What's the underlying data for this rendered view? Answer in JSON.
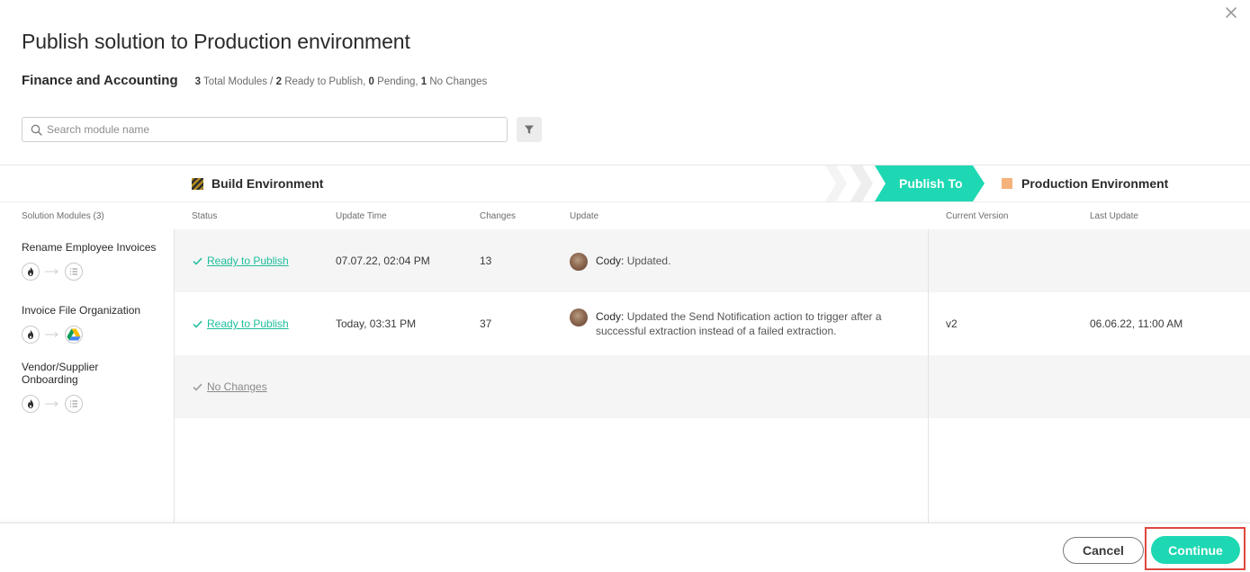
{
  "dialog": {
    "title": "Publish solution to Production environment",
    "close_icon": "close-icon"
  },
  "solution": {
    "name": "Finance and Accounting",
    "summary": {
      "total": "3",
      "total_label": "Total Modules /",
      "ready": "2",
      "ready_label": "Ready to Publish,",
      "pending": "0",
      "pending_label": "Pending,",
      "no_changes": "1",
      "no_changes_label": "No Changes"
    }
  },
  "search": {
    "placeholder": "Search module name",
    "value": "",
    "icon": "search-icon"
  },
  "filter": {
    "icon": "filter-icon"
  },
  "environments": {
    "source": "Build Environment",
    "action": "Publish To",
    "target": "Production Environment",
    "colors": {
      "publish_to": "#1dd8b3",
      "production": "#f5b27a",
      "build_stripe_1": "#b38b1e",
      "build_stripe_2": "#2e2e2e"
    }
  },
  "columns": {
    "modules": "Solution Modules (3)",
    "status": "Status",
    "update_time": "Update Time",
    "changes": "Changes",
    "update": "Update",
    "current_version": "Current Version",
    "last_update": "Last Update"
  },
  "rows": [
    {
      "name": "Rename Employee Invoices",
      "source_icon": "fire-icon",
      "target_icon": "list-icon",
      "status": "Ready to Publish",
      "update_time": "07.07.22, 02:04 PM",
      "changes": "13",
      "update_author": "Cody:",
      "update_text": "Updated.",
      "current_version": "",
      "last_update": ""
    },
    {
      "name": "Invoice File Organization",
      "source_icon": "fire-icon",
      "target_icon": "google-drive-icon",
      "status": "Ready to Publish",
      "update_time": "Today, 03:31 PM",
      "changes": "37",
      "update_author": "Cody:",
      "update_text": "Updated the Send Notification action to trigger after a successful extraction instead of a failed extraction.",
      "current_version": "v2",
      "last_update": "06.06.22, 11:00 AM"
    },
    {
      "name": "Vendor/Supplier Onboarding",
      "source_icon": "fire-icon",
      "target_icon": "list-icon",
      "status": "No Changes",
      "update_time": "",
      "changes": "",
      "update_author": "",
      "update_text": "",
      "current_version": "",
      "last_update": ""
    }
  ],
  "footer": {
    "cancel_label": "Cancel",
    "continue_label": "Continue",
    "accent": "#1dd8b3",
    "highlight": "#e0473f"
  }
}
